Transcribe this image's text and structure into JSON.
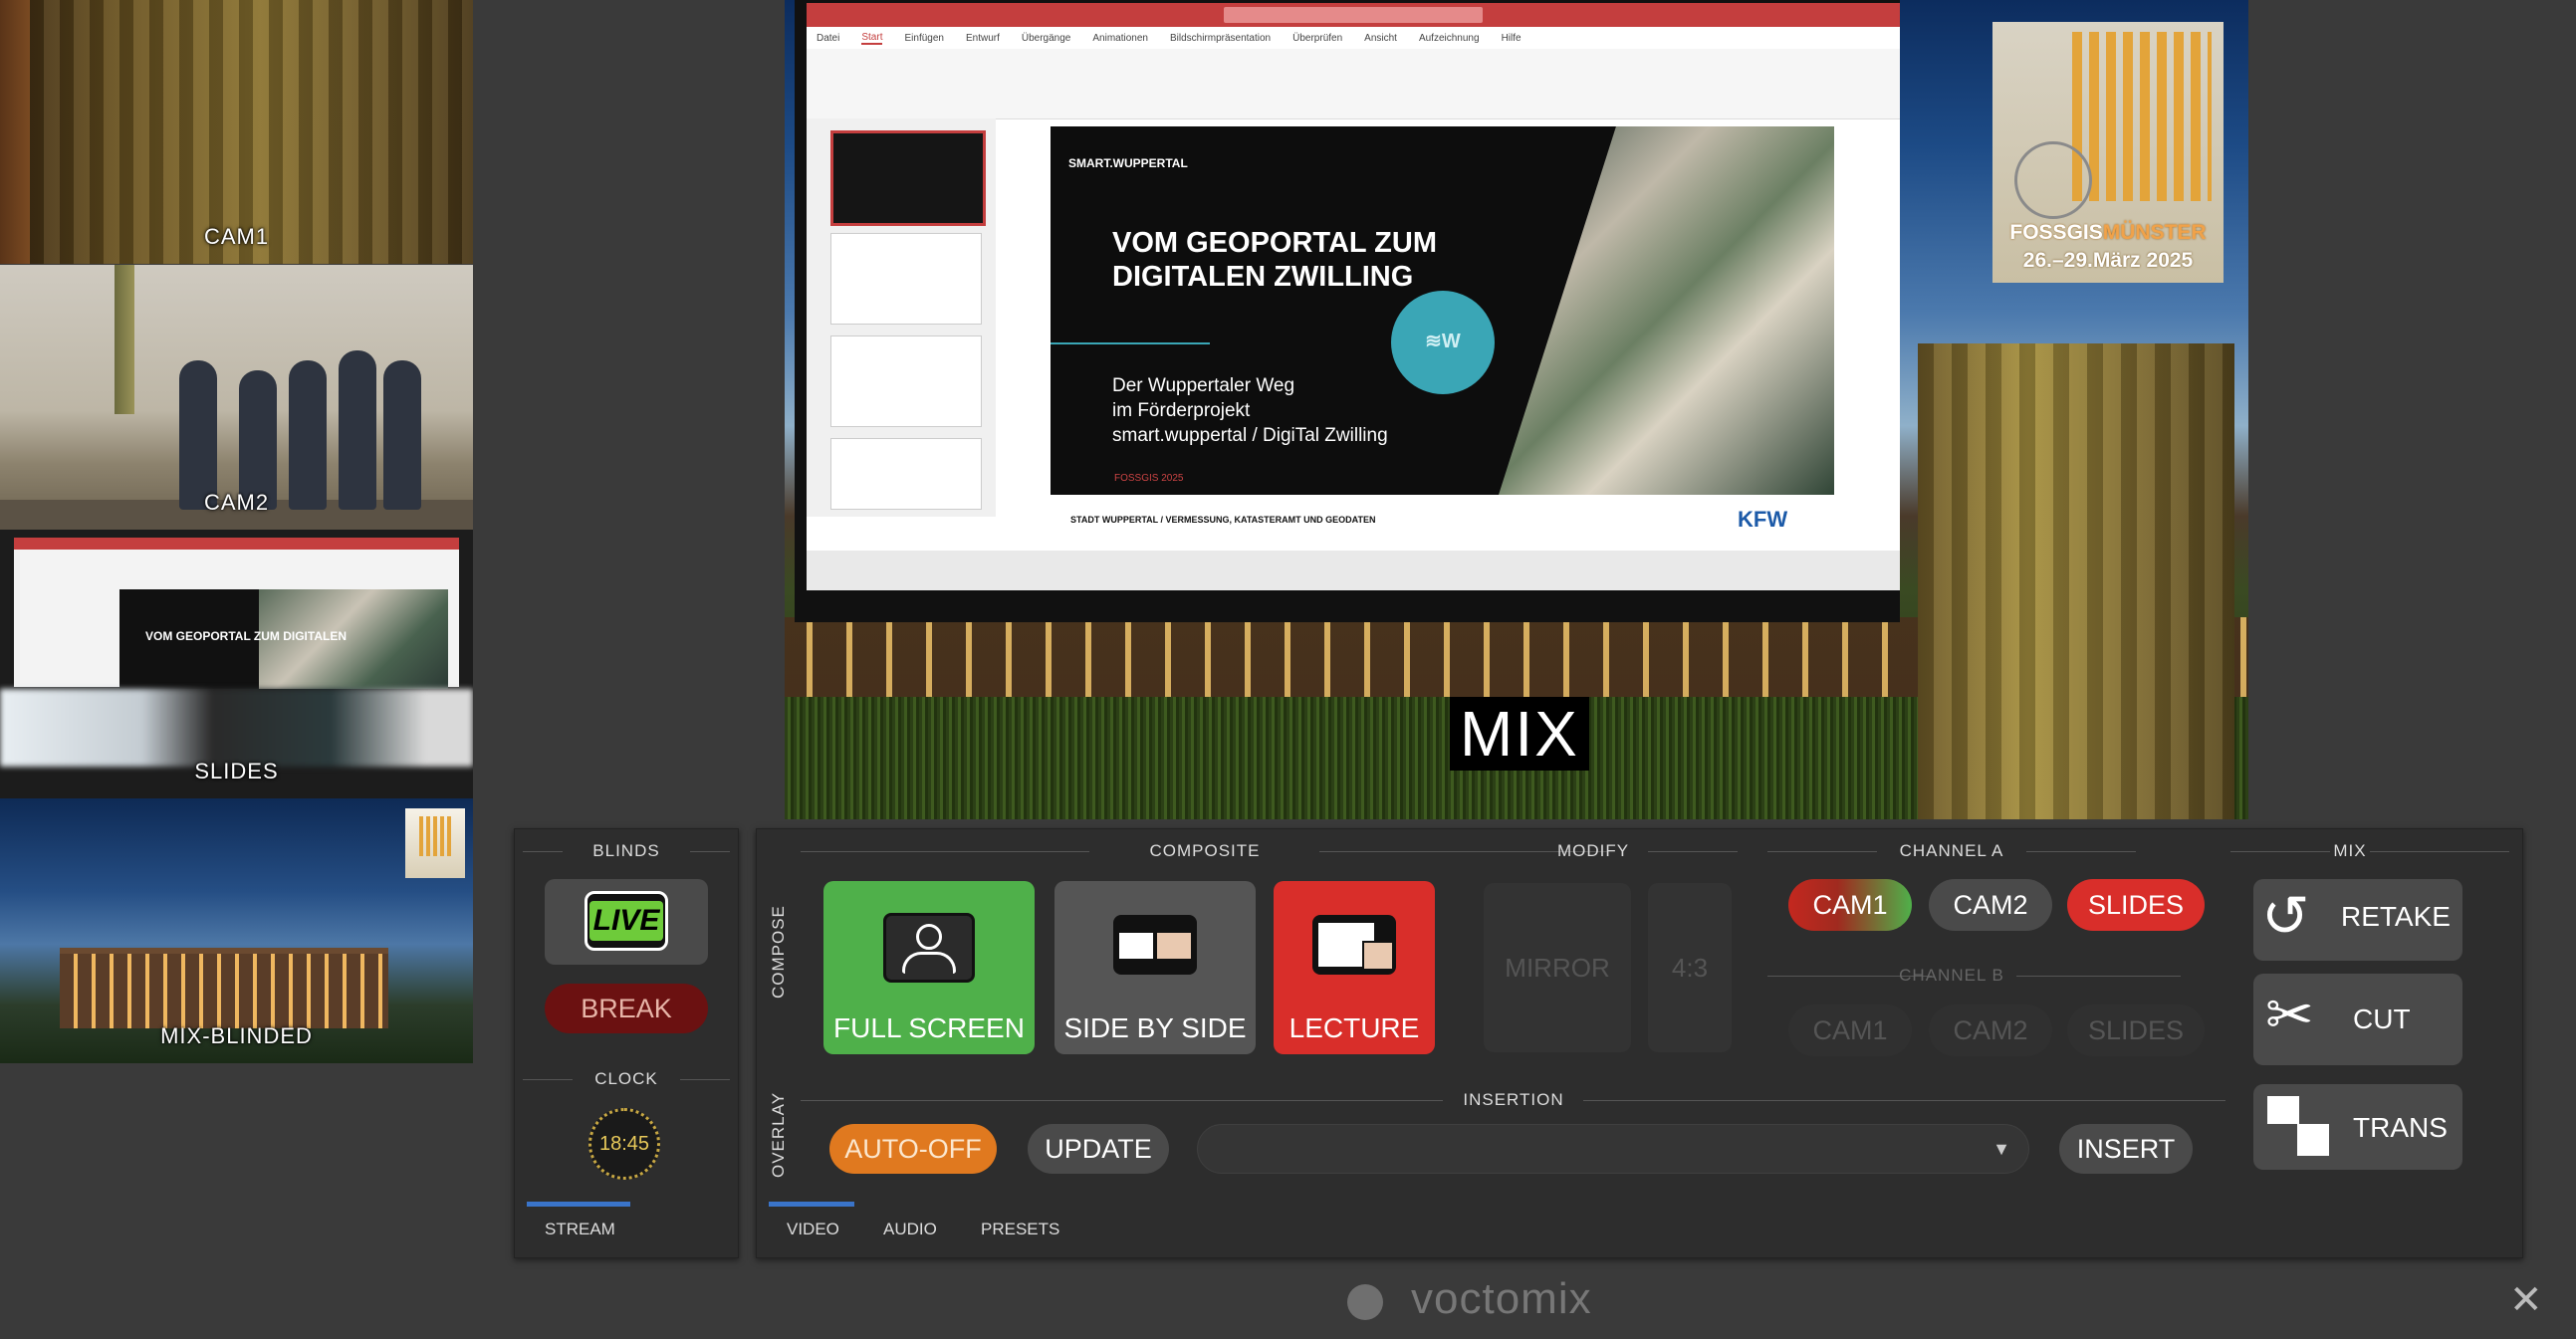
{
  "previews": {
    "cam1": "CAM1",
    "cam2": "CAM2",
    "slides": "SLIDES",
    "mix_blinded": "MIX-BLINDED"
  },
  "program": {
    "mix_label": "MIX",
    "slide": {
      "brand": "SMART.WUPPERTAL",
      "title": "VOM GEOPORTAL ZUM DIGITALEN ZWILLING",
      "subtitle_1": "Der Wuppertaler Weg",
      "subtitle_2": "im Förderprojekt",
      "subtitle_3": "smart.wuppertal / DigiTal Zwilling",
      "conference": "FOSSGIS 2025",
      "circle_logo": "≋W",
      "footer": "STADT WUPPERTAL / VERMESSUNG, KATASTERAMT UND GEODATEN",
      "footer_logo": "KFW",
      "thumbnail_text": "VOM GEOPORTAL ZUM DIGITALEN"
    },
    "ppt_tabs": [
      "Datei",
      "Start",
      "Einfügen",
      "Entwurf",
      "Übergänge",
      "Animationen",
      "Bildschirmpräsentation",
      "Überprüfen",
      "Ansicht",
      "Aufzeichnung",
      "Hilfe"
    ],
    "event_logo": {
      "line1_a": "FOSSGIS",
      "line1_b": "MÜNSTER",
      "line2": "26.–29.März 2025"
    }
  },
  "blinds": {
    "title": "BLINDS",
    "live_label": "LIVE",
    "break_label": "BREAK",
    "clock_title": "CLOCK",
    "clock_time": "18:45",
    "stream_tab": "STREAM"
  },
  "composite": {
    "title": "COMPOSITE",
    "vertical_label": "COMPOSE",
    "buttons": [
      "FULL SCREEN",
      "SIDE BY SIDE",
      "LECTURE"
    ]
  },
  "modify": {
    "title": "MODIFY",
    "mirror": "MIRROR",
    "aspect": "4:3"
  },
  "channel_a": {
    "title": "CHANNEL A",
    "buttons": [
      "CAM1",
      "CAM2",
      "SLIDES"
    ]
  },
  "channel_b": {
    "title": "CHANNEL B",
    "buttons": [
      "CAM1",
      "CAM2",
      "SLIDES"
    ]
  },
  "mix": {
    "title": "MIX",
    "retake": "RETAKE",
    "cut": "CUT",
    "trans": "TRANS"
  },
  "overlay": {
    "vertical_label": "OVERLAY",
    "insertion_title": "INSERTION",
    "auto_off": "AUTO-OFF",
    "update": "UPDATE",
    "insert": "INSERT",
    "dropdown_value": ""
  },
  "tabs": [
    "VIDEO",
    "AUDIO",
    "PRESETS"
  ],
  "footer": {
    "brand": "voctomix",
    "close": "✕"
  },
  "colors": {
    "green": "#4fb04a",
    "red": "#d92e2a",
    "orange": "#e0791f",
    "tab_accent": "#3a74c9"
  }
}
